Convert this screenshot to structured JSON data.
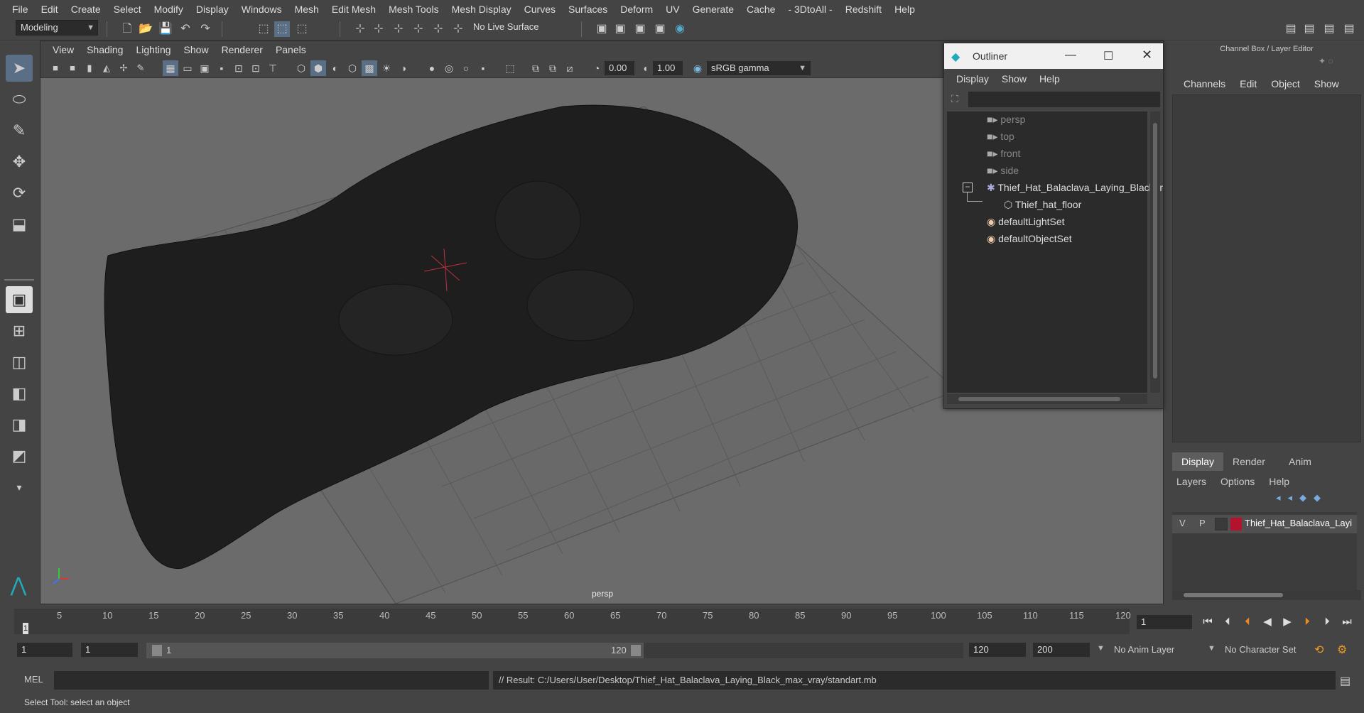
{
  "menubar": [
    "File",
    "Edit",
    "Create",
    "Select",
    "Modify",
    "Display",
    "Windows",
    "Mesh",
    "Edit Mesh",
    "Mesh Tools",
    "Mesh Display",
    "Curves",
    "Surfaces",
    "Deform",
    "UV",
    "Generate",
    "Cache",
    "- 3DtoAll -",
    "Redshift",
    "Help"
  ],
  "toolbar": {
    "mode": "Modeling",
    "live_surface": "No Live Surface"
  },
  "viewport": {
    "menu": [
      "View",
      "Shading",
      "Lighting",
      "Show",
      "Renderer",
      "Panels"
    ],
    "exposure": "0.00",
    "gamma": "1.00",
    "color_space": "sRGB gamma",
    "camera_label": "persp"
  },
  "outliner": {
    "title": "Outliner",
    "menu": [
      "Display",
      "Show",
      "Help"
    ],
    "items": [
      {
        "label": "persp",
        "kind": "camera"
      },
      {
        "label": "top",
        "kind": "camera"
      },
      {
        "label": "front",
        "kind": "camera"
      },
      {
        "label": "side",
        "kind": "camera"
      },
      {
        "label": "Thief_Hat_Balaclava_Laying_Black_r",
        "kind": "group"
      },
      {
        "label": "Thief_hat_floor",
        "kind": "mesh"
      },
      {
        "label": "defaultLightSet",
        "kind": "set"
      },
      {
        "label": "defaultObjectSet",
        "kind": "set"
      }
    ]
  },
  "channel_box": {
    "title": "Channel Box / Layer Editor",
    "menu": [
      "Channels",
      "Edit",
      "Object",
      "Show"
    ]
  },
  "layer_editor": {
    "tabs": [
      "Display",
      "Render",
      "Anim"
    ],
    "menu": [
      "Layers",
      "Options",
      "Help"
    ],
    "layer": {
      "v": "V",
      "p": "P",
      "name": "Thief_Hat_Balaclava_Layi",
      "color": "#b5122e"
    }
  },
  "timeline": {
    "ticks": [
      "5",
      "10",
      "15",
      "20",
      "25",
      "30",
      "35",
      "40",
      "45",
      "50",
      "55",
      "60",
      "65",
      "70",
      "75",
      "80",
      "85",
      "90",
      "95",
      "100",
      "105",
      "110",
      "115",
      "120"
    ],
    "current_marker": "1",
    "current_frame": "1"
  },
  "range": {
    "start": "1",
    "anim_start": "1",
    "slider_start": "1",
    "slider_end": "120",
    "end": "120",
    "anim_end": "200",
    "anim_layer": "No Anim Layer",
    "character_set": "No Character Set"
  },
  "command": {
    "lang": "MEL",
    "result": "// Result: C:/Users/User/Desktop/Thief_Hat_Balaclava_Laying_Black_max_vray/standart.mb"
  },
  "status": "Select Tool: select an object"
}
